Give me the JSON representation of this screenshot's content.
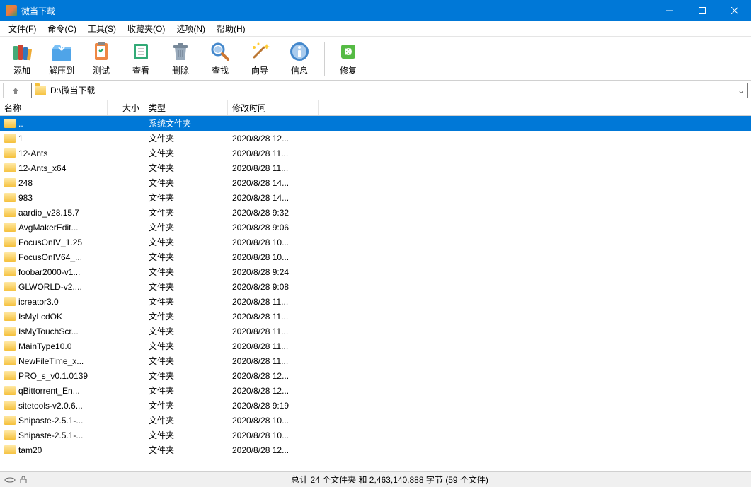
{
  "titlebar": {
    "title": "微当下载"
  },
  "menubar": {
    "items": [
      "文件(F)",
      "命令(C)",
      "工具(S)",
      "收藏夹(O)",
      "选项(N)",
      "帮助(H)"
    ]
  },
  "toolbar": {
    "buttons": [
      {
        "label": "添加",
        "icon": "add"
      },
      {
        "label": "解压到",
        "icon": "extract"
      },
      {
        "label": "测试",
        "icon": "test"
      },
      {
        "label": "查看",
        "icon": "view"
      },
      {
        "label": "删除",
        "icon": "delete"
      },
      {
        "label": "查找",
        "icon": "find"
      },
      {
        "label": "向导",
        "icon": "wizard"
      },
      {
        "label": "信息",
        "icon": "info"
      }
    ],
    "repair": {
      "label": "修复",
      "icon": "repair"
    }
  },
  "addressbar": {
    "path": "D:\\微当下载"
  },
  "columns": {
    "name": "名称",
    "size": "大小",
    "type": "类型",
    "date": "修改时间"
  },
  "files": [
    {
      "name": "..",
      "size": "",
      "type": "系统文件夹",
      "date": "",
      "selected": true
    },
    {
      "name": "1",
      "size": "",
      "type": "文件夹",
      "date": "2020/8/28 12..."
    },
    {
      "name": "12-Ants",
      "size": "",
      "type": "文件夹",
      "date": "2020/8/28 11..."
    },
    {
      "name": "12-Ants_x64",
      "size": "",
      "type": "文件夹",
      "date": "2020/8/28 11..."
    },
    {
      "name": "248",
      "size": "",
      "type": "文件夹",
      "date": "2020/8/28 14..."
    },
    {
      "name": "983",
      "size": "",
      "type": "文件夹",
      "date": "2020/8/28 14..."
    },
    {
      "name": "aardio_v28.15.7",
      "size": "",
      "type": "文件夹",
      "date": "2020/8/28 9:32"
    },
    {
      "name": "AvgMakerEdit...",
      "size": "",
      "type": "文件夹",
      "date": "2020/8/28 9:06"
    },
    {
      "name": "FocusOnIV_1.25",
      "size": "",
      "type": "文件夹",
      "date": "2020/8/28 10..."
    },
    {
      "name": "FocusOnIV64_...",
      "size": "",
      "type": "文件夹",
      "date": "2020/8/28 10..."
    },
    {
      "name": "foobar2000-v1...",
      "size": "",
      "type": "文件夹",
      "date": "2020/8/28 9:24"
    },
    {
      "name": "GLWORLD-v2....",
      "size": "",
      "type": "文件夹",
      "date": "2020/8/28 9:08"
    },
    {
      "name": "icreator3.0",
      "size": "",
      "type": "文件夹",
      "date": "2020/8/28 11..."
    },
    {
      "name": "IsMyLcdOK",
      "size": "",
      "type": "文件夹",
      "date": "2020/8/28 11..."
    },
    {
      "name": "IsMyTouchScr...",
      "size": "",
      "type": "文件夹",
      "date": "2020/8/28 11..."
    },
    {
      "name": "MainType10.0",
      "size": "",
      "type": "文件夹",
      "date": "2020/8/28 11..."
    },
    {
      "name": "NewFileTime_x...",
      "size": "",
      "type": "文件夹",
      "date": "2020/8/28 11..."
    },
    {
      "name": "PRO_s_v0.1.0139",
      "size": "",
      "type": "文件夹",
      "date": "2020/8/28 12..."
    },
    {
      "name": "qBittorrent_En...",
      "size": "",
      "type": "文件夹",
      "date": "2020/8/28 12..."
    },
    {
      "name": "sitetools-v2.0.6...",
      "size": "",
      "type": "文件夹",
      "date": "2020/8/28 9:19"
    },
    {
      "name": "Snipaste-2.5.1-...",
      "size": "",
      "type": "文件夹",
      "date": "2020/8/28 10..."
    },
    {
      "name": "Snipaste-2.5.1-...",
      "size": "",
      "type": "文件夹",
      "date": "2020/8/28 10..."
    },
    {
      "name": "tam20",
      "size": "",
      "type": "文件夹",
      "date": "2020/8/28 12..."
    }
  ],
  "statusbar": {
    "text": "总计 24 个文件夹 和 2,463,140,888 字节 (59 个文件)"
  },
  "icons": {
    "add_svg": "books",
    "extract_svg": "folder-out",
    "test_svg": "clipboard",
    "view_svg": "book",
    "delete_svg": "trash",
    "find_svg": "magnify",
    "wizard_svg": "wand",
    "info_svg": "info",
    "repair_svg": "tools"
  }
}
